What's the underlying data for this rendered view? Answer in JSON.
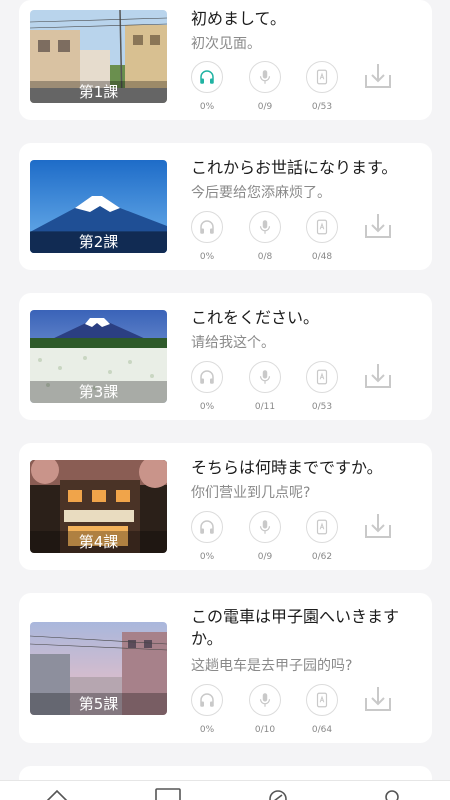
{
  "colors": {
    "accent": "#21b3a3",
    "icon_inactive": "#c9c9c9",
    "card_bg": "#ffffff",
    "page_bg": "#f4f4f6"
  },
  "lessons": [
    {
      "label": "第1課",
      "title": "初めまして。",
      "subtitle": "初次见面。",
      "listen": "0%",
      "speak": "0/9",
      "words": "0/53",
      "listen_active": true
    },
    {
      "label": "第2課",
      "title": "これからお世話になります。",
      "subtitle": "今后要给您添麻烦了。",
      "listen": "0%",
      "speak": "0/8",
      "words": "0/48",
      "listen_active": false
    },
    {
      "label": "第3課",
      "title": "これをください。",
      "subtitle": "请给我这个。",
      "listen": "0%",
      "speak": "0/11",
      "words": "0/53",
      "listen_active": false
    },
    {
      "label": "第4課",
      "title": "そちらは何時までですか。",
      "subtitle": "你们营业到几点呢?",
      "listen": "0%",
      "speak": "0/9",
      "words": "0/62",
      "listen_active": false
    },
    {
      "label": "第5課",
      "title": "この電車は甲子園へいきますか。",
      "subtitle": "这趟电车是去甲子园的吗?",
      "listen": "0%",
      "speak": "0/10",
      "words": "0/64",
      "listen_active": false
    }
  ],
  "icons": {
    "listen": "headphones-icon",
    "speak": "microphone-icon",
    "words": "flashcard-icon",
    "download": "download-icon"
  },
  "tabbar": [
    "home-icon",
    "book-icon",
    "compass-icon",
    "profile-icon"
  ]
}
